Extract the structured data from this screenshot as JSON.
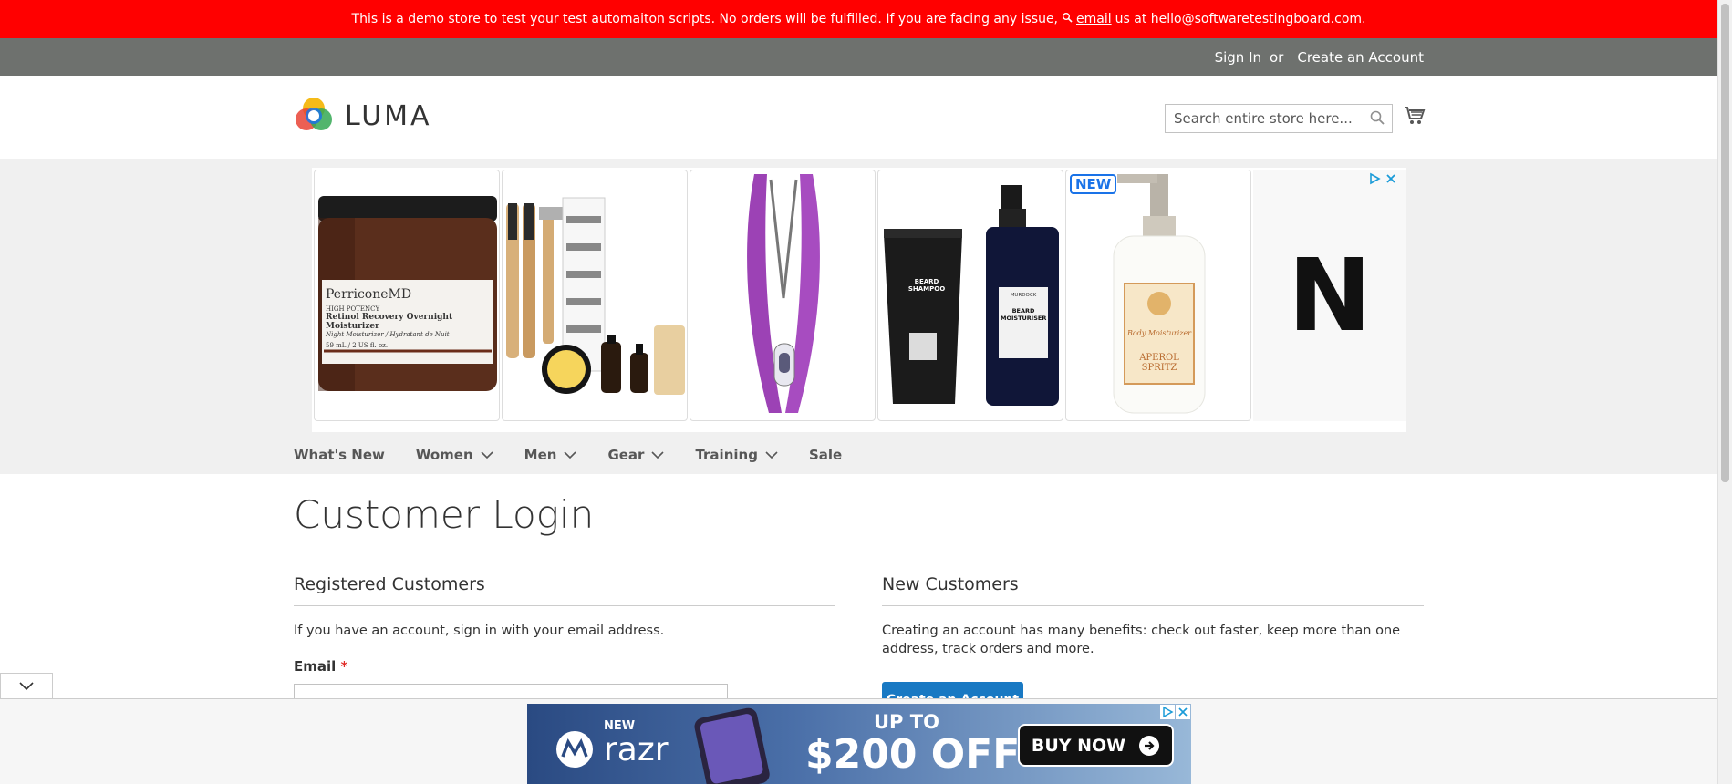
{
  "demo_notice": {
    "text_before": "This is a demo store to test your test automaiton scripts. No orders will be fulfilled. If you are facing any issue,",
    "email_link": "email",
    "text_after": "us at hello@softwaretestingboard.com."
  },
  "panel": {
    "sign_in": "Sign In",
    "or": "or",
    "create_account": "Create an Account"
  },
  "header": {
    "logo_text": "LUMA",
    "search_placeholder": "Search entire store here..."
  },
  "ad": {
    "badge": "NEW",
    "tiles": [
      {
        "brand": "PerriconeMD",
        "line1": "HIGH POTENCY",
        "line2": "Retinol Recovery Overnight Moisturizer",
        "line3": "Night Moisturizer / Hydratant de Nuit",
        "line4": "59 mL / 2 US fl. oz."
      },
      {
        "label": "grooming kit"
      },
      {
        "label": "tweezers"
      },
      {
        "left": "BEARD SHAMPOO",
        "right": "BEARD MOISTURISER",
        "brand": "MURDOCK"
      },
      {
        "label1": "Body Moisturizer",
        "label2": "APEROL SPRITZ"
      }
    ],
    "end_letter": "N"
  },
  "nav": {
    "items": [
      {
        "label": "What's New",
        "dropdown": false
      },
      {
        "label": "Women",
        "dropdown": true
      },
      {
        "label": "Men",
        "dropdown": true
      },
      {
        "label": "Gear",
        "dropdown": true
      },
      {
        "label": "Training",
        "dropdown": true
      },
      {
        "label": "Sale",
        "dropdown": false
      }
    ]
  },
  "main": {
    "title": "Customer Login",
    "registered": {
      "title": "Registered Customers",
      "text": "If you have an account, sign in with your email address.",
      "email_label": "Email",
      "required_mark": "*"
    },
    "new_customers": {
      "title": "New Customers",
      "text": "Creating an account has many benefits: check out faster, keep more than one address, track orders and more.",
      "button": "Create an Account"
    }
  },
  "bottom_ad": {
    "new": "NEW",
    "product": "razr",
    "up_to": "UP TO",
    "offer": "$200 OFF",
    "cta": "BUY NOW"
  },
  "colors": {
    "demo_bar": "#ff0000",
    "panel_bar": "#6e716e",
    "primary_button": "#1979c3",
    "required": "#e02b27"
  }
}
